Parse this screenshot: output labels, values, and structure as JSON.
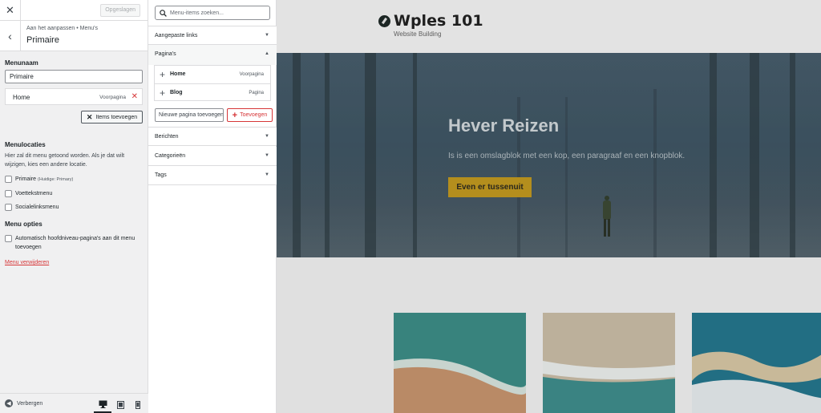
{
  "topbar": {
    "close_label": "✕",
    "saved_label": "Opgeslagen"
  },
  "section": {
    "back_label": "‹",
    "crumb": "Aan het aanpassen • Menu's",
    "title": "Primaire"
  },
  "menu_name": {
    "label": "Menunaam",
    "value": "Primaire"
  },
  "menu_items": [
    {
      "title": "Home",
      "type": "Voorpagina"
    }
  ],
  "add_items_label": "Items toevoegen",
  "locations": {
    "heading": "Menulocaties",
    "description": "Hier zal dit menu getoond worden. Als je dat wilt wijzigen, kies een andere locatie.",
    "options": [
      {
        "label": "Primaire",
        "note": "(Huidige: Primary)"
      },
      {
        "label": "Voettekstmenu",
        "note": ""
      },
      {
        "label": "Socialelinksmenu",
        "note": ""
      }
    ]
  },
  "menu_options": {
    "heading": "Menu opties",
    "auto_add_label": "Automatisch hoofdniveau-pagina's aan dit menu toevoegen"
  },
  "delete_menu_label": "Menu verwijderen",
  "footer": {
    "hide_label": "Verbergen",
    "active_device": "desktop"
  },
  "available": {
    "search_placeholder": "Menu-items zoeken...",
    "sections": [
      {
        "title": "Aangepaste links",
        "open": false
      },
      {
        "title": "Pagina's",
        "open": true
      },
      {
        "title": "Berichten",
        "open": false
      },
      {
        "title": "Categorieën",
        "open": false
      },
      {
        "title": "Tags",
        "open": false
      }
    ],
    "pages": [
      {
        "title": "Home",
        "type": "Voorpagina"
      },
      {
        "title": "Blog",
        "type": "Pagina"
      }
    ],
    "new_page_placeholder": "Nieuwe pagina toevoegen",
    "add_button_label": "Toevoegen"
  },
  "preview": {
    "site_title": "Wples 101",
    "tagline": "Website Building",
    "cover_title": "Hever Reizen",
    "cover_text": "Is is een omslagblok met een kop, een paragraaf en een knopblok.",
    "cover_button": "Even er tussenuit"
  },
  "colors": {
    "accent_red": "#d63638",
    "button_gold": "#c49b20",
    "panel_bg": "#f0f0f1"
  }
}
